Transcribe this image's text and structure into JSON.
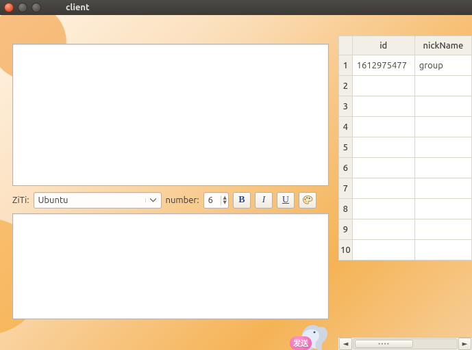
{
  "window": {
    "title": "client"
  },
  "format": {
    "font_label": "ZiTi:",
    "font_value": "Ubuntu",
    "size_label": "number:",
    "size_value": "6",
    "bold_glyph": "B",
    "italic_glyph": "I",
    "underline_glyph": "U"
  },
  "send": {
    "label": "发送"
  },
  "table": {
    "columns": [
      "id",
      "nickName"
    ],
    "rows": [
      {
        "n": "1",
        "id": "1612975477",
        "nick": "group"
      },
      {
        "n": "2",
        "id": "",
        "nick": ""
      },
      {
        "n": "3",
        "id": "",
        "nick": ""
      },
      {
        "n": "4",
        "id": "",
        "nick": ""
      },
      {
        "n": "5",
        "id": "",
        "nick": ""
      },
      {
        "n": "6",
        "id": "",
        "nick": ""
      },
      {
        "n": "7",
        "id": "",
        "nick": ""
      },
      {
        "n": "8",
        "id": "",
        "nick": ""
      },
      {
        "n": "9",
        "id": "",
        "nick": ""
      },
      {
        "n": "10",
        "id": "",
        "nick": ""
      }
    ],
    "scroll_thumb_label": "••••"
  }
}
